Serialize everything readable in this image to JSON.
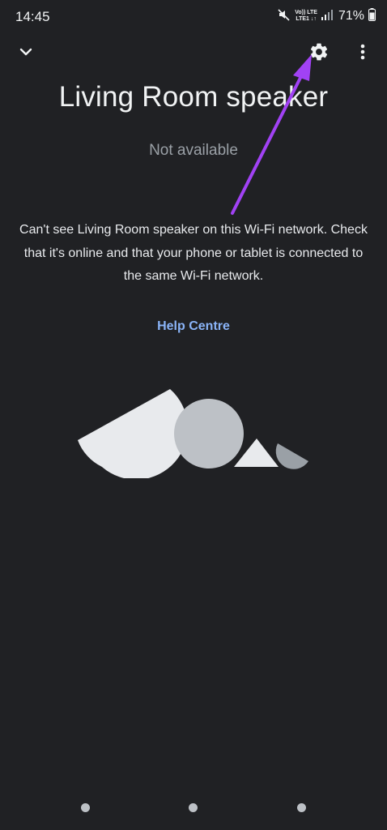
{
  "status_bar": {
    "time": "14:45",
    "net_line1": "Vo)) LTE",
    "net_line2": "LTE1 ↓↑",
    "battery": "71%"
  },
  "device": {
    "title": "Living Room speaker",
    "status": "Not available"
  },
  "message": {
    "text": "Can't see Living Room speaker on this Wi-Fi network. Check that it's online and that your phone or tablet is connected to the same Wi-Fi network."
  },
  "help": {
    "label": "Help Centre"
  },
  "icons": {
    "back": "chevron-down-icon",
    "settings": "gear-icon",
    "menu": "more-vertical-icon",
    "mute": "mute-icon",
    "signal": "signal-icon",
    "battery": "battery-icon"
  },
  "colors": {
    "background": "#202124",
    "link": "#8ab4f8",
    "annotation_arrow": "#a142f4"
  },
  "pager": {
    "pages": 3
  }
}
